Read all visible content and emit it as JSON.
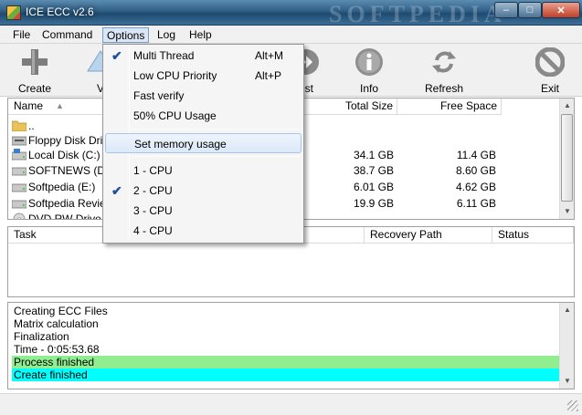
{
  "window": {
    "title": "ICE ECC v2.6",
    "watermark": "SOFTPEDIA",
    "min_glyph": "–",
    "max_glyph": "□",
    "close_glyph": "✕"
  },
  "menubar": {
    "file": "File",
    "command": "Command",
    "options": "Options",
    "log": "Log",
    "help": "Help"
  },
  "toolbar": {
    "create": "Create",
    "verify": "V",
    "test": "est",
    "info": "Info",
    "refresh": "Refresh",
    "exit": "Exit"
  },
  "filelist": {
    "columns": {
      "name": "Name",
      "total_size": "Total Size",
      "free_space": "Free Space"
    },
    "rows": [
      {
        "name": "..",
        "total": "",
        "free": "",
        "icon": "folder-icon"
      },
      {
        "name": "Floppy Disk Driv",
        "total": "",
        "free": "",
        "icon": "floppy-drive-icon"
      },
      {
        "name": "Local Disk (C:)",
        "total": "34.1 GB",
        "free": "11.4 GB",
        "icon": "hard-drive-icon"
      },
      {
        "name": "SOFTNEWS (D:)",
        "total": "38.7 GB",
        "free": "8.60 GB",
        "icon": "hard-drive-icon"
      },
      {
        "name": "Softpedia (E:)",
        "total": "6.01 GB",
        "free": "4.62 GB",
        "icon": "hard-drive-icon"
      },
      {
        "name": "Softpedia Revie",
        "total": "19.9 GB",
        "free": "6.11 GB",
        "icon": "hard-drive-icon"
      },
      {
        "name": "DVD RW Drive (",
        "total": "",
        "free": "",
        "icon": "dvd-drive-icon"
      }
    ]
  },
  "tasklist": {
    "columns": {
      "task": "Task",
      "recovery_path": "Recovery Path",
      "status": "Status"
    }
  },
  "log": {
    "lines": [
      {
        "text": "Creating ECC Files",
        "bg": ""
      },
      {
        "text": "Matrix calculation",
        "bg": ""
      },
      {
        "text": "Finalization",
        "bg": ""
      },
      {
        "text": "Time - 0:05:53.68",
        "bg": ""
      },
      {
        "text": "Process finished",
        "bg": "#90ee90"
      },
      {
        "text": "Create finished",
        "bg": "#00ffff"
      }
    ]
  },
  "options_menu": {
    "multi_thread": "Multi Thread",
    "multi_thread_key": "Alt+M",
    "low_cpu": "Low CPU Priority",
    "low_cpu_key": "Alt+P",
    "fast_verify": "Fast verify",
    "cpu_usage": "50% CPU Usage",
    "set_memory": "Set memory usage",
    "cpu1": "1 - CPU",
    "cpu2": "2 - CPU",
    "cpu3": "3 - CPU",
    "cpu4": "4 - CPU",
    "checked": [
      "multi_thread",
      "cpu2"
    ],
    "check_glyph": "✔"
  },
  "colors": {
    "accent": "#1f4fa0",
    "process_finished": "#90ee90",
    "create_finished": "#00ffff"
  }
}
